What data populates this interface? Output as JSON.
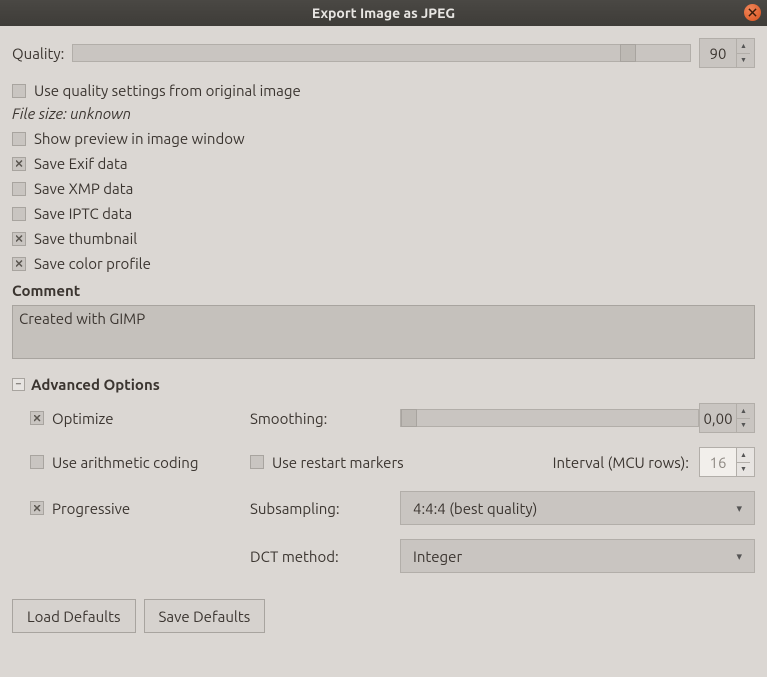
{
  "title": "Export Image as JPEG",
  "quality": {
    "label": "Quality:",
    "value": "90",
    "percent": 90
  },
  "options": {
    "use_original_quality": {
      "label": "Use quality settings from original image",
      "checked": false
    },
    "file_size": "File size: unknown",
    "show_preview": {
      "label": "Show preview in image window",
      "checked": false
    },
    "save_exif": {
      "label": "Save Exif data",
      "checked": true
    },
    "save_xmp": {
      "label": "Save XMP data",
      "checked": false
    },
    "save_iptc": {
      "label": "Save IPTC data",
      "checked": false
    },
    "save_thumbnail": {
      "label": "Save thumbnail",
      "checked": true
    },
    "save_color_profile": {
      "label": "Save color profile",
      "checked": true
    }
  },
  "comment": {
    "heading": "Comment",
    "text": "Created with GIMP"
  },
  "advanced": {
    "heading": "Advanced Options",
    "optimize": {
      "label": "Optimize",
      "checked": true
    },
    "smoothing": {
      "label": "Smoothing:",
      "value": "0,00",
      "percent": 0
    },
    "arithmetic": {
      "label": "Use arithmetic coding",
      "checked": false
    },
    "restart_markers": {
      "label": "Use restart markers",
      "checked": false
    },
    "interval": {
      "label": "Interval (MCU rows):",
      "value": "16",
      "enabled": false
    },
    "progressive": {
      "label": "Progressive",
      "checked": true
    },
    "subsampling": {
      "label": "Subsampling:",
      "value": "4:4:4 (best quality)"
    },
    "dct": {
      "label": "DCT method:",
      "value": "Integer"
    }
  },
  "buttons": {
    "load_defaults": "Load Defaults",
    "save_defaults": "Save Defaults"
  }
}
